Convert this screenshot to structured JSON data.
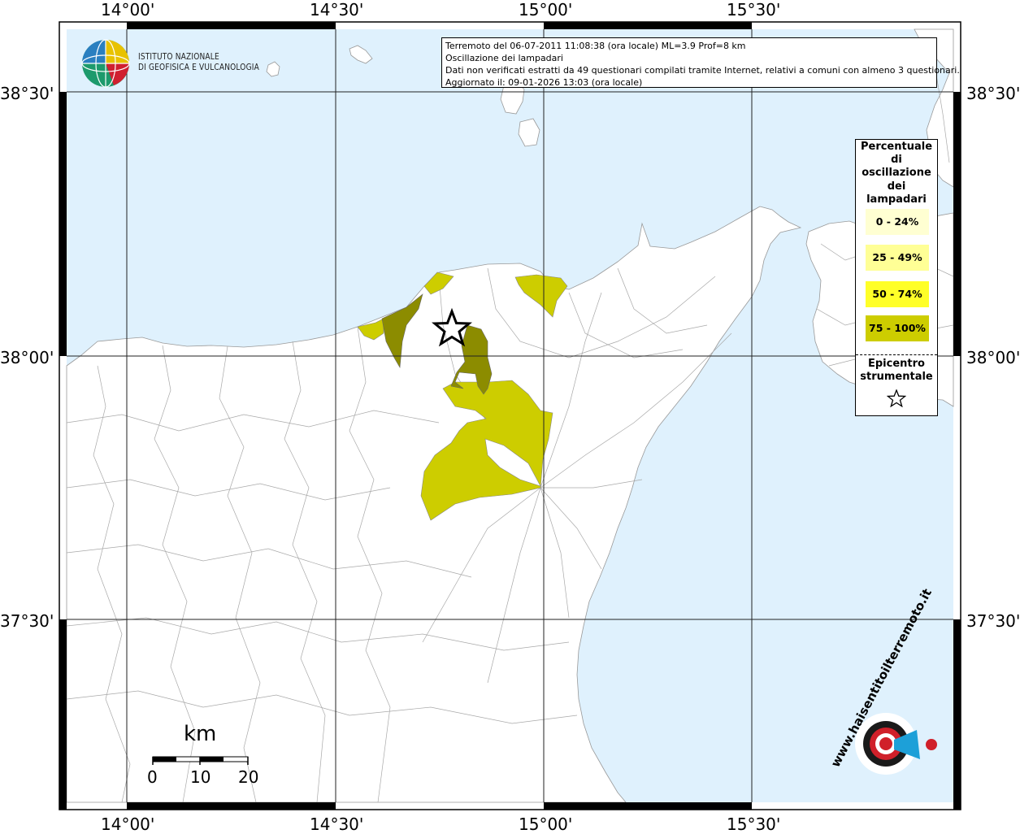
{
  "coords": {
    "top": [
      "14°00'",
      "14°30'",
      "15°00'",
      "15°30'"
    ],
    "bottom": [
      "14°00'",
      "14°30'",
      "15°00'",
      "15°30'"
    ],
    "left": [
      "38°30'",
      "38°00'",
      "37°30'"
    ],
    "right": [
      "38°30'",
      "38°00'",
      "37°30'"
    ]
  },
  "info": {
    "line1": "Terremoto del 06-07-2011 11:08:38 (ora locale) ML=3.9 Prof=8 km",
    "line2": "Oscillazione dei lampadari",
    "line3": "Dati non verificati estratti da 49 questionari compilati tramite Internet, relativi a comuni con almeno 3 questionari.",
    "line4": "Aggiornato il: 09-01-2026 13:03 (ora locale)"
  },
  "logo": {
    "line1": "ISTITUTO NAZIONALE",
    "line2": "DI GEOFISICA E VULCANOLOGIA"
  },
  "legend": {
    "title": [
      "Percentuale",
      "di",
      "oscillazione",
      "dei",
      "lampadari"
    ],
    "classes": [
      {
        "label": "0 - 24%",
        "color": "#ffffd2"
      },
      {
        "label": "25 - 49%",
        "color": "#ffff96"
      },
      {
        "label": "50 - 74%",
        "color": "#ffff28"
      },
      {
        "label": "75 - 100%",
        "color": "#cdcd00"
      }
    ],
    "epicenter": [
      "Epicentro",
      "strumentale"
    ]
  },
  "scale": {
    "unit": "km",
    "ticks": [
      "0",
      "10",
      "20"
    ]
  },
  "badge": {
    "text": "www.haisentitoilterremoto.it"
  },
  "colors": {
    "sea": "#dff1fd",
    "land": "#ffffff",
    "class_50_74": "#cdcd00",
    "class_75_100": "#8c8c00",
    "badge_red": "#d0202a",
    "badge_blue": "#1da0d8"
  }
}
